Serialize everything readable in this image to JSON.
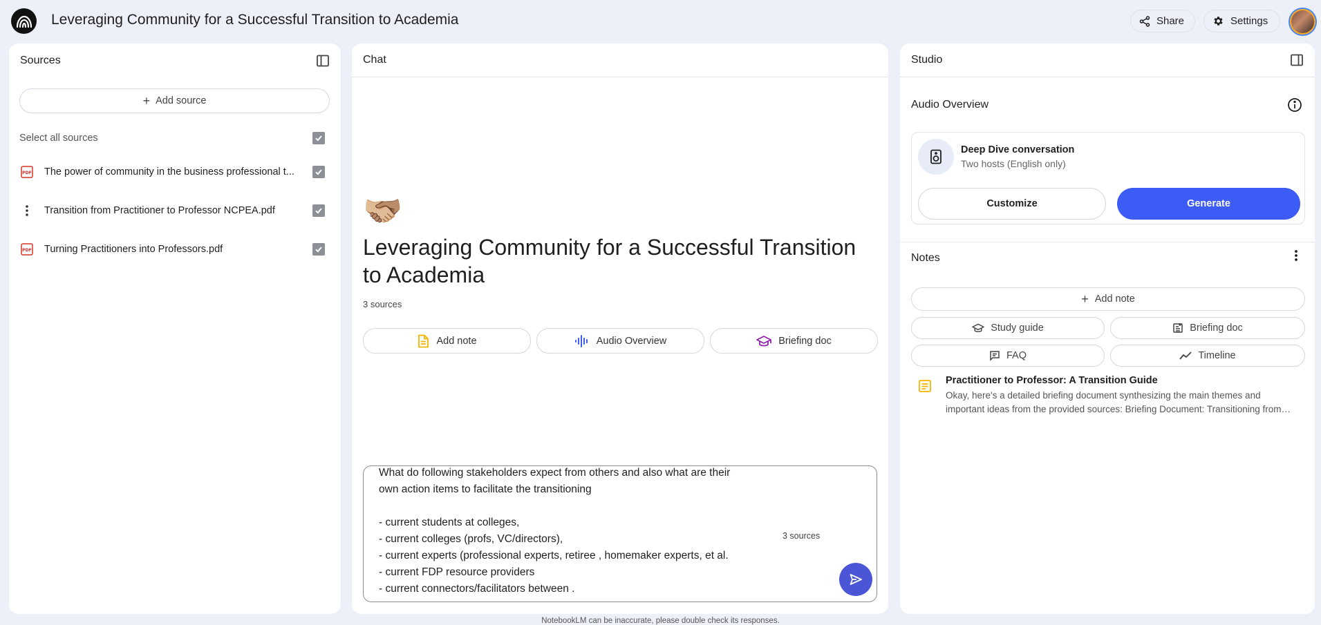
{
  "header": {
    "title": "Leveraging Community for a Successful Transition to Academia",
    "share_label": "Share",
    "settings_label": "Settings"
  },
  "sources_panel": {
    "title": "Sources",
    "add_source_label": "Add source",
    "select_all_label": "Select all sources",
    "items": [
      {
        "name": "The power of community in the business professional t...",
        "icon": "pdf-icon",
        "checked": true
      },
      {
        "name": "Transition from Practitioner to Professor NCPEA.pdf",
        "icon": "more-vert-icon",
        "checked": true
      },
      {
        "name": "Turning Practitioners into Professors.pdf",
        "icon": "pdf-icon",
        "checked": true
      }
    ]
  },
  "chat_panel": {
    "title": "Chat",
    "emoji": "🫱🏼‍🫲🏽",
    "notebook_title": "Leveraging Community for a Successful Transition to Academia",
    "source_count": "3 sources",
    "actions": {
      "add_note": "Add note",
      "audio_overview": "Audio Overview",
      "briefing_doc": "Briefing doc"
    },
    "query_text": "What do following stakeholders expect from others and also what are their\nown action items to facilitate the transitioning\n\n- current students at colleges,\n- current colleges (profs, VC/directors),\n- current experts (professional experts, retiree , homemaker experts, et al.\n- current FDP resource providers\n- current connectors/facilitators between .",
    "query_sources": "3 sources"
  },
  "studio_panel": {
    "title": "Studio",
    "audio_overview_title": "Audio Overview",
    "deep_dive_title": "Deep Dive conversation",
    "deep_dive_subtitle": "Two hosts (English only)",
    "customize_label": "Customize",
    "generate_label": "Generate",
    "notes_title": "Notes",
    "add_note_label": "Add note",
    "study_guide_label": "Study guide",
    "briefing_doc_label": "Briefing doc",
    "faq_label": "FAQ",
    "timeline_label": "Timeline",
    "note": {
      "title": "Practitioner to Professor: A Transition Guide",
      "preview": "Okay, here's a detailed briefing document synthesizing the main themes and important ideas from the provided sources: Briefing Document: Transitioning from Practitioner to Professor"
    }
  },
  "footer": {
    "disclaimer": "NotebookLM can be inaccurate, please double check its responses."
  },
  "colors": {
    "background": "#eef0f9",
    "accent": "#3c5cf5",
    "send_button": "#4a56d6",
    "pdf_red": "#d93025",
    "note_yellow": "#f4b400"
  }
}
